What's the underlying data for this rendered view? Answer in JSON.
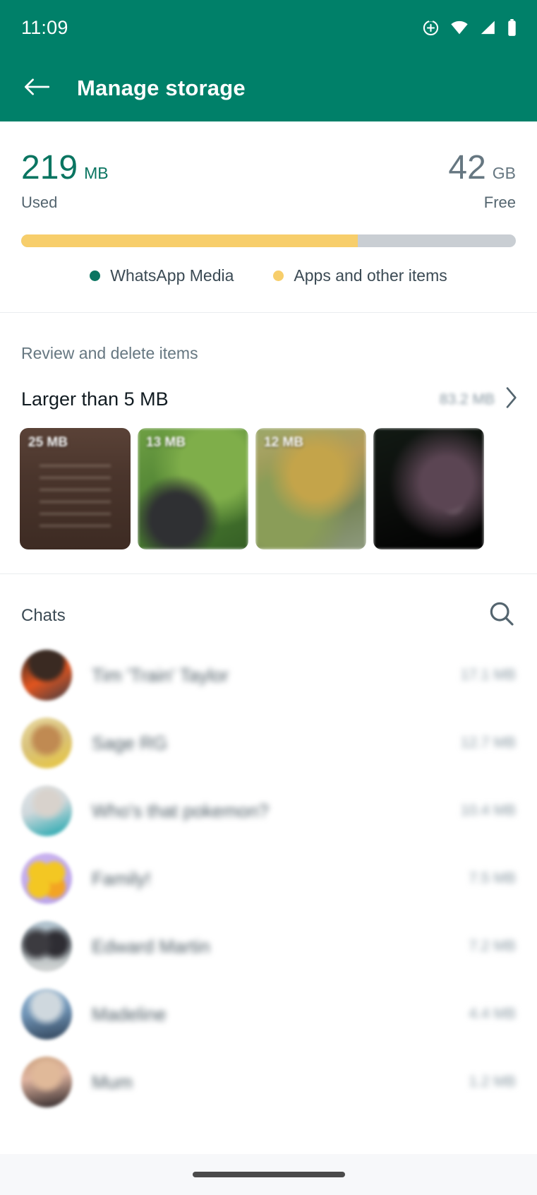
{
  "status_bar": {
    "time": "11:09",
    "icons": [
      "alarm-plus-icon",
      "wifi-icon",
      "cellular-signal-icon",
      "battery-icon"
    ]
  },
  "app_bar": {
    "back_icon": "back-arrow-icon",
    "title": "Manage storage"
  },
  "storage_summary": {
    "used": {
      "value": "219",
      "unit": "MB",
      "label": "Used",
      "color": "#0a7561"
    },
    "free": {
      "value": "42",
      "unit": "GB",
      "label": "Free",
      "color": "#667781"
    },
    "bar": {
      "used_percent": 68,
      "used_color": "#f7ce6b",
      "free_color": "#c9ced3"
    },
    "legend": [
      {
        "label": "WhatsApp Media",
        "color": "#0a7561"
      },
      {
        "label": "Apps and other items",
        "color": "#f7ce6b"
      }
    ]
  },
  "review_section": {
    "heading": "Review and delete items",
    "larger_than": {
      "label": "Larger than 5 MB",
      "size": "83.2 MB",
      "chevron_icon": "chevron-right-icon"
    },
    "thumbnails": [
      {
        "size": "25 MB",
        "art": "tb1"
      },
      {
        "size": "13 MB",
        "art": "tb2"
      },
      {
        "size": "12 MB",
        "art": "tb3"
      },
      {
        "size": "",
        "art": "tb4"
      }
    ]
  },
  "chats_section": {
    "title": "Chats",
    "search_icon": "search-icon",
    "rows": [
      {
        "name": "Tim 'Train' Taylor",
        "size": "17.1 MB",
        "avatar": "av1"
      },
      {
        "name": "Sage RG",
        "size": "12.7 MB",
        "avatar": "av2"
      },
      {
        "name": "Who's that pokemon?",
        "size": "10.4 MB",
        "avatar": "av3"
      },
      {
        "name": "Family!",
        "size": "7.5 MB",
        "avatar": "av4"
      },
      {
        "name": "Edward Martin",
        "size": "7.2 MB",
        "avatar": "av5"
      },
      {
        "name": "Madeline",
        "size": "4.4 MB",
        "avatar": "av6"
      },
      {
        "name": "Mum",
        "size": "1.2 MB",
        "avatar": "av7"
      }
    ]
  },
  "nav_bar": {
    "pill": "gesture-nav-pill"
  }
}
